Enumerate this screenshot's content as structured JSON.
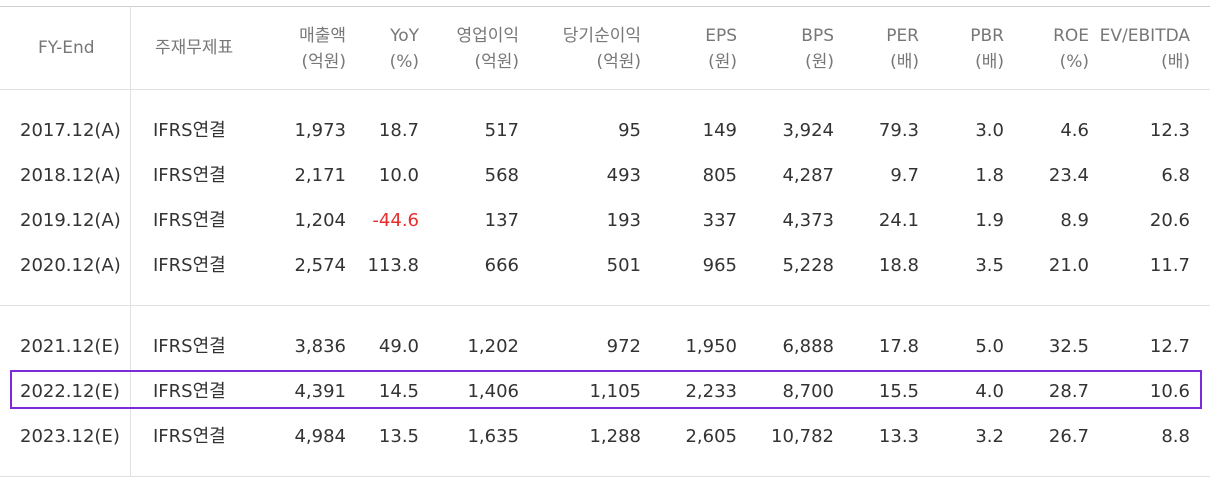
{
  "headers": [
    {
      "l1": "FY-End",
      "l2": ""
    },
    {
      "l1": "주재무제표",
      "l2": ""
    },
    {
      "l1": "매출액",
      "l2": "(억원)"
    },
    {
      "l1": "YoY",
      "l2": "(%)"
    },
    {
      "l1": "영업이익",
      "l2": "(억원)"
    },
    {
      "l1": "당기순이익",
      "l2": "(억원)"
    },
    {
      "l1": "EPS",
      "l2": "(원)"
    },
    {
      "l1": "BPS",
      "l2": "(원)"
    },
    {
      "l1": "PER",
      "l2": "(배)"
    },
    {
      "l1": "PBR",
      "l2": "(배)"
    },
    {
      "l1": "ROE",
      "l2": "(%)"
    },
    {
      "l1": "EV/EBITDA",
      "l2": "(배)"
    }
  ],
  "actual_rows": [
    [
      "2017.12(A)",
      "IFRS연결",
      "1,973",
      "18.7",
      "517",
      "95",
      "149",
      "3,924",
      "79.3",
      "3.0",
      "4.6",
      "12.3"
    ],
    [
      "2018.12(A)",
      "IFRS연결",
      "2,171",
      "10.0",
      "568",
      "493",
      "805",
      "4,287",
      "9.7",
      "1.8",
      "23.4",
      "6.8"
    ],
    [
      "2019.12(A)",
      "IFRS연결",
      "1,204",
      "-44.6",
      "137",
      "193",
      "337",
      "4,373",
      "24.1",
      "1.9",
      "8.9",
      "20.6"
    ],
    [
      "2020.12(A)",
      "IFRS연결",
      "2,574",
      "113.8",
      "666",
      "501",
      "965",
      "5,228",
      "18.8",
      "3.5",
      "21.0",
      "11.7"
    ]
  ],
  "estimate_rows": [
    [
      "2021.12(E)",
      "IFRS연결",
      "3,836",
      "49.0",
      "1,202",
      "972",
      "1,950",
      "6,888",
      "17.8",
      "5.0",
      "32.5",
      "12.7"
    ],
    [
      "2022.12(E)",
      "IFRS연결",
      "4,391",
      "14.5",
      "1,406",
      "1,105",
      "2,233",
      "8,700",
      "15.5",
      "4.0",
      "28.7",
      "10.6"
    ],
    [
      "2023.12(E)",
      "IFRS연결",
      "4,984",
      "13.5",
      "1,635",
      "1,288",
      "2,605",
      "10,782",
      "13.3",
      "3.2",
      "26.7",
      "8.8"
    ]
  ],
  "highlighted_row": "2022.12(E)",
  "colors": {
    "negative": "#e62e2e",
    "highlight_border": "#7b2bd9",
    "header_text": "#777777",
    "body_text": "#333333",
    "grid": "#e0e0e0"
  }
}
